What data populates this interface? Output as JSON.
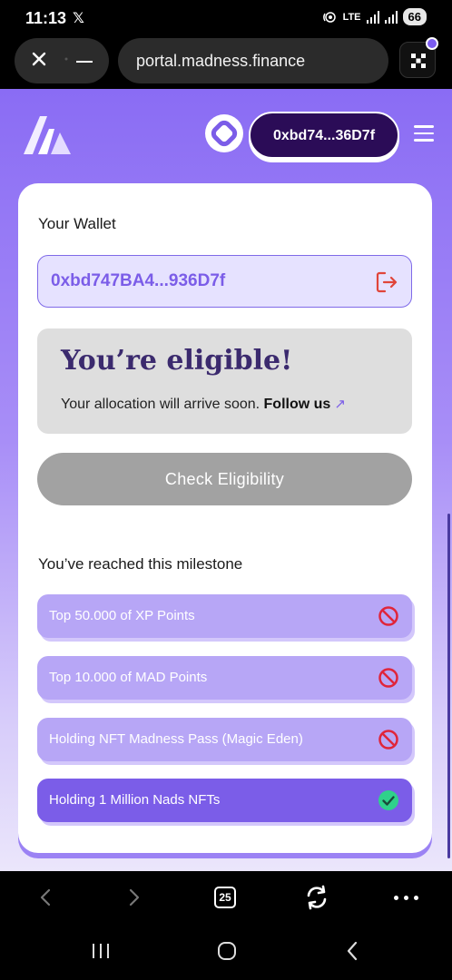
{
  "status_bar": {
    "time": "11:13",
    "x_icon_text": "𝕏",
    "network": "LTE",
    "battery": "66"
  },
  "browser": {
    "url": "portal.madness.finance",
    "tab_count": "25"
  },
  "header": {
    "wallet_short": "0xbd74...36D7f"
  },
  "card": {
    "wallet_label": "Your Wallet",
    "wallet_address": "0xbd747BA4...936D7f",
    "eligibility_title": "You’re eligible!",
    "eligibility_text": "Your allocation will arrive soon.",
    "follow_link": "Follow us",
    "check_button": "Check Eligibility",
    "milestone_label": "You’ve reached this milestone",
    "milestones": [
      {
        "label": "Top 50.000 of XP Points",
        "status": "not-reached"
      },
      {
        "label": "Top 10.000 of MAD Points",
        "status": "not-reached"
      },
      {
        "label": "Holding NFT Madness Pass (Magic Eden)",
        "status": "not-reached"
      },
      {
        "label": "Holding 1 Million Nads NFTs",
        "status": "reached"
      }
    ]
  },
  "colors": {
    "accent": "#7b5de8",
    "wallet_pill": "#2b0c57",
    "danger": "#e0253a",
    "success": "#2fd18b"
  }
}
